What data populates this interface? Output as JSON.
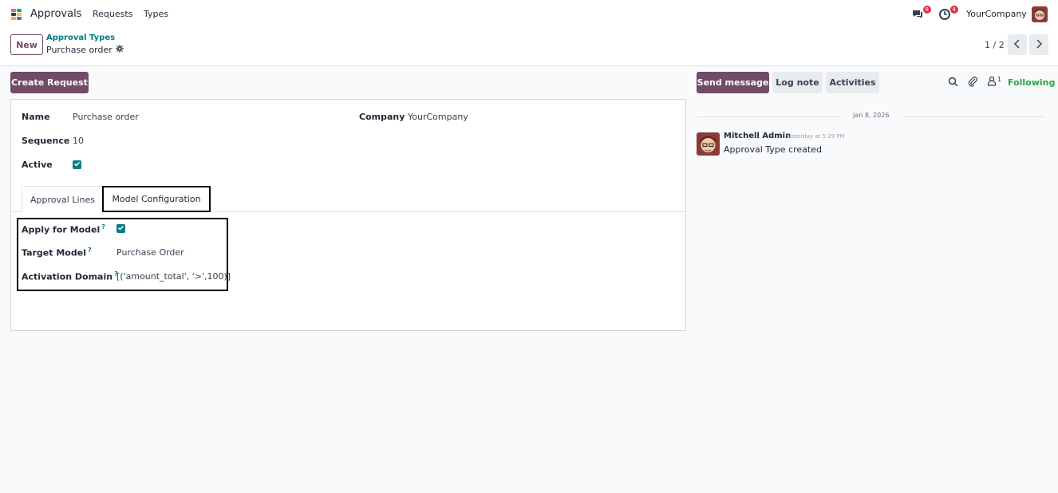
{
  "app": {
    "name": "Approvals",
    "logo_icon": "approvals-app-icon"
  },
  "menu": [
    {
      "label": "Requests"
    },
    {
      "label": "Types"
    }
  ],
  "systray": {
    "messages_count": "8",
    "activities_count": "4",
    "company": "YourCompany"
  },
  "control": {
    "new_label": "New",
    "breadcrumb_parent": "Approval Types",
    "breadcrumb_current": "Purchase order",
    "pager": "1 / 2"
  },
  "actions": {
    "create_request": "Create Request"
  },
  "form": {
    "name_label": "Name",
    "name_value": "Purchase order",
    "company_label": "Company",
    "company_value": "YourCompany",
    "sequence_label": "Sequence",
    "sequence_value": "10",
    "active_label": "Active",
    "active_checked": true,
    "tabs": [
      {
        "label": "Approval Lines"
      },
      {
        "label": "Model Configuration"
      }
    ],
    "active_tab": "Model Configuration",
    "apply_model_label": "Apply for Model",
    "apply_model_checked": true,
    "target_model_label": "Target Model",
    "target_model_value": "Purchase Order",
    "domain_label": "Activation Domain",
    "domain_value": "[('amount_total', '>',100)]",
    "help_mark": "?"
  },
  "chatter": {
    "send_message": "Send message",
    "log_note": "Log note",
    "activities": "Activities",
    "followers_count": "1",
    "following": "Following",
    "date": "Jan 8, 2026",
    "message": {
      "author": "Mitchell Admin",
      "time": "Yesterday at 5:29 PM",
      "body": "Approval Type created"
    }
  },
  "colors": {
    "brand": "#714B67",
    "accent": "#017e84",
    "following": "#28a745",
    "badge": "#dc3545"
  }
}
